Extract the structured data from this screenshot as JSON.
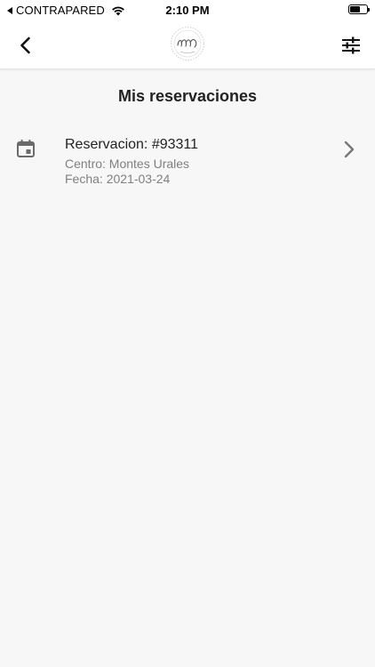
{
  "status_bar": {
    "carrier": "CONTRAPARED",
    "time": "2:10 PM",
    "battery_level": 0.6
  },
  "header": {
    "back_icon": "chevron-left-icon",
    "logo_icon": "brand-logo",
    "filter_icon": "tune-sliders-icon"
  },
  "page": {
    "title": "Mis reservaciones"
  },
  "reservations": [
    {
      "icon": "calendar-icon",
      "title": "Reservacion: #93311",
      "center": "Centro: Montes Urales",
      "date": "Fecha: 2021-03-24"
    }
  ],
  "colors": {
    "background": "#f7f7f7",
    "header_bg": "#ffffff",
    "text_primary": "#222222",
    "text_secondary": "#808080",
    "icon_gray": "#6b6b6b"
  }
}
